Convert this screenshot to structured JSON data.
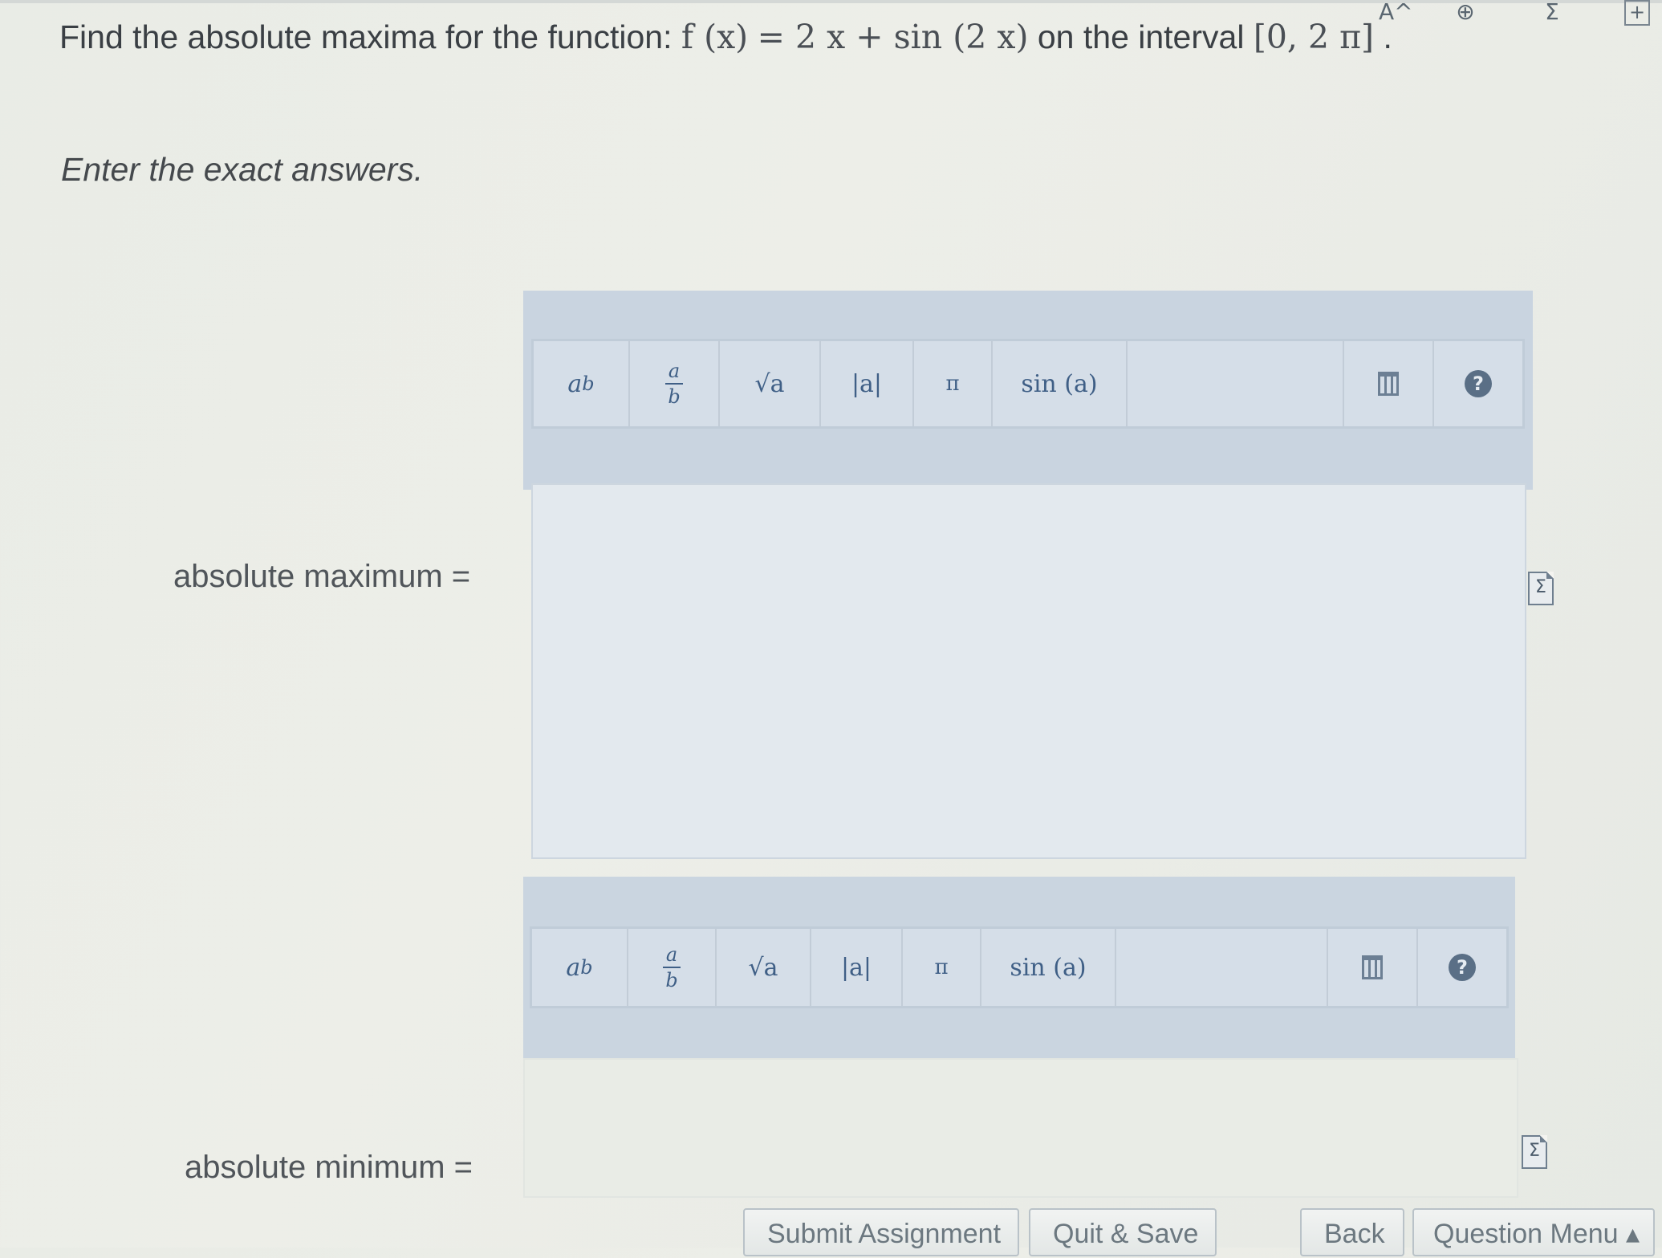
{
  "top_icons": [
    "A^",
    "zoom-icon",
    "formula-list-icon",
    "add-icon"
  ],
  "question": {
    "prefix": "Find the absolute maxima for the function: ",
    "func_lhs": "f (x)",
    "func_rhs": "= 2 x + sin (2 x)",
    "middle": " on the interval ",
    "interval": "[0, 2 π]",
    "end": "."
  },
  "instruction": "Enter the exact answers.",
  "toolbar": {
    "power_a": "a",
    "power_b": "b",
    "frac_num": "a",
    "frac_den": "b",
    "sqrt": "√a",
    "abs": "|a|",
    "pi": "π",
    "sin": "sin (a)",
    "help": "?"
  },
  "answers": {
    "max_label": "absolute maximum =",
    "max_value": "",
    "min_label": "absolute minimum =",
    "min_value": ""
  },
  "sigma": "Σ",
  "buttons": {
    "submit": "Submit Assignment",
    "quit": "Quit & Save",
    "back": "Back",
    "menu": "Question Menu ▴"
  }
}
